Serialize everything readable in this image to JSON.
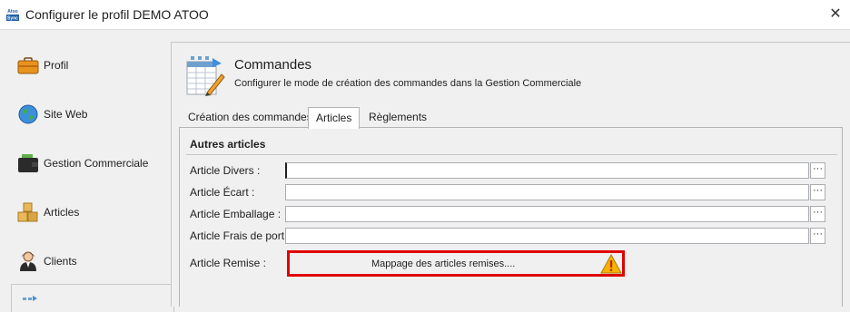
{
  "window": {
    "title": "Configurer le profil DEMO ATOO",
    "app_icon_text": "Atoo Sync",
    "close_glyph": "✕"
  },
  "sidebar": {
    "items": [
      {
        "label": "Profil",
        "icon": "briefcase-icon"
      },
      {
        "label": "Site Web",
        "icon": "globe-icon"
      },
      {
        "label": "Gestion Commerciale",
        "icon": "wallet-icon"
      },
      {
        "label": "Articles",
        "icon": "boxes-icon"
      },
      {
        "label": "Clients",
        "icon": "person-icon"
      }
    ],
    "selected_icon": "orders-icon"
  },
  "header": {
    "title": "Commandes",
    "description": "Configurer le mode de création des commandes dans la Gestion Commerciale",
    "icon": "order-sheet-icon"
  },
  "tabs": [
    {
      "label": "Création des commandes"
    },
    {
      "label": "Articles",
      "active": true
    },
    {
      "label": "Règlements"
    }
  ],
  "section": {
    "title": "Autres articles",
    "rows": [
      {
        "label": "Article Divers :",
        "value": "",
        "button": "···"
      },
      {
        "label": "Article Écart :",
        "value": "",
        "button": "···"
      },
      {
        "label": "Article Emballage :",
        "value": "",
        "button": "···"
      },
      {
        "label": "Article Frais de port :",
        "value": "",
        "button": "···"
      }
    ],
    "remise": {
      "label": "Article Remise :",
      "button_label": "Mappage des articles remises....",
      "icon": "warning-icon"
    }
  },
  "colors": {
    "highlight": "#e00000",
    "warning": "#f5b400"
  }
}
